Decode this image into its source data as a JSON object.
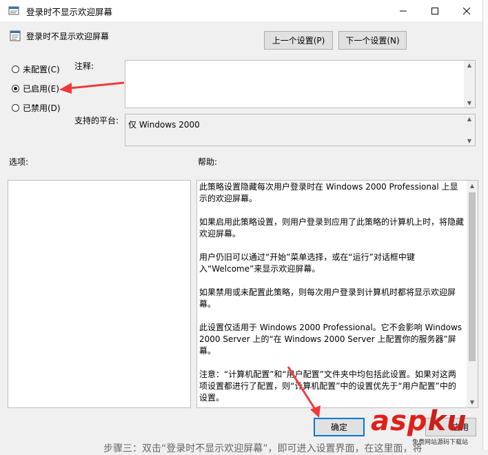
{
  "window": {
    "title": "登录时不显示欢迎屏幕",
    "controls": [
      "minimize",
      "maximize",
      "close"
    ]
  },
  "header": {
    "policy_name": "登录时不显示欢迎屏幕",
    "prev_button": "上一个设置(P)",
    "next_button": "下一个设置(N)"
  },
  "state": {
    "options": [
      {
        "label": "未配置(C)",
        "selected": false
      },
      {
        "label": "已启用(E)",
        "selected": true
      },
      {
        "label": "已禁用(D)",
        "selected": false
      }
    ]
  },
  "comment": {
    "label": "注释:",
    "value": ""
  },
  "platform": {
    "label": "支持的平台:",
    "value": "仅 Windows 2000"
  },
  "options_panel": {
    "label": "选项:"
  },
  "help": {
    "label": "帮助:",
    "paragraphs": [
      "此策略设置隐藏每次用户登录时在 Windows 2000 Professional 上显示的欢迎屏幕。",
      "如果启用此策略设置，则用户登录到应用了此策略的计算机上时，将隐藏欢迎屏幕。",
      "用户仍旧可以通过“开始”菜单选择，或在“运行”对话框中键入“Welcome”来显示欢迎屏幕。",
      "如果禁用或未配置此策略，则每次用户登录到计算机时都将显示欢迎屏幕。",
      "此设置仅适用于 Windows 2000 Professional。它不会影响 Windows 2000 Server 上的“在 Windows 2000 Server 上配置你的服务器”屏幕。",
      "注意：“计算机配置”和“用户配置”文件夹中均包括此设置。如果对这两项设置都进行了配置，则“计算机配置”中的设置优先于“用户配置”中的设置。"
    ]
  },
  "footer": {
    "ok_button": "确定",
    "apply_button": "应用",
    "caption": "步骤三：双击“登录时不显示欢迎屏幕”，即可进入设置界面，在这里面，将"
  },
  "watermark": {
    "brand_a": "asp",
    "brand_b": "ku",
    "sub": "免费网站源码下载站"
  },
  "annotations": {
    "arrow_color": "#f0383a"
  }
}
